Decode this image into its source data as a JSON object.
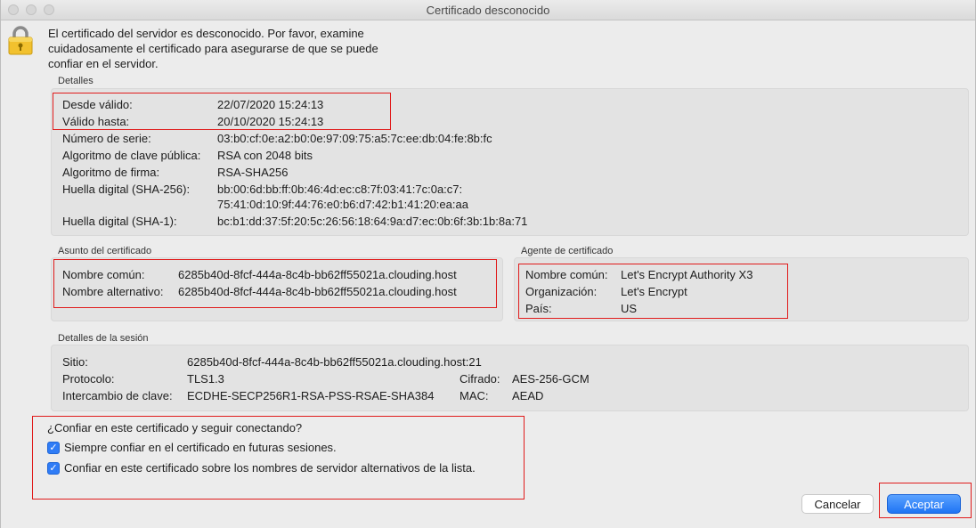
{
  "window": {
    "title": "Certificado desconocido"
  },
  "intro_text_lines": [
    "El certificado del servidor es desconocido. Por favor, examine",
    "cuidadosamente el certificado para asegurarse de que se puede",
    "confiar en el servidor."
  ],
  "details": {
    "label": "Detalles",
    "valid_from_label": "Desde válido:",
    "valid_from": "22/07/2020 15:24:13",
    "valid_until_label": "Válido hasta:",
    "valid_until": "20/10/2020 15:24:13",
    "serial_label": "Número de serie:",
    "serial": "03:b0:cf:0e:a2:b0:0e:97:09:75:a5:7c:ee:db:04:fe:8b:fc",
    "pubkey_label": "Algoritmo de clave pública:",
    "pubkey": "RSA con 2048 bits",
    "sig_label": "Algoritmo de firma:",
    "sig": "RSA-SHA256",
    "sha256_label": "Huella digital (SHA-256):",
    "sha256_line1": "bb:00:6d:bb:ff:0b:46:4d:ec:c8:7f:03:41:7c:0a:c7:",
    "sha256_line2": "75:41:0d:10:9f:44:76:e0:b6:d7:42:b1:41:20:ea:aa",
    "sha1_label": "Huella digital (SHA-1):",
    "sha1": "bc:b1:dd:37:5f:20:5c:26:56:18:64:9a:d7:ec:0b:6f:3b:1b:8a:71"
  },
  "subject": {
    "label": "Asunto del certificado",
    "cn_label": "Nombre común:",
    "cn": "6285b40d-8fcf-444a-8c4b-bb62ff55021a.clouding.host",
    "alt_label": "Nombre alternativo:",
    "alt": "6285b40d-8fcf-444a-8c4b-bb62ff55021a.clouding.host"
  },
  "issuer": {
    "label": "Agente de certificado",
    "cn_label": "Nombre común:",
    "cn": "Let's Encrypt Authority X3",
    "org_label": "Organización:",
    "org": "Let's Encrypt",
    "country_label": "País:",
    "country": "US"
  },
  "session": {
    "label": "Detalles de la sesión",
    "site_label": "Sitio:",
    "site": "6285b40d-8fcf-444a-8c4b-bb62ff55021a.clouding.host:21",
    "protocol_label": "Protocolo:",
    "protocol": "TLS1.3",
    "cipher_label": "Cifrado:",
    "cipher": "AES-256-GCM",
    "kex_label": "Intercambio de clave:",
    "kex": "ECDHE-SECP256R1-RSA-PSS-RSAE-SHA384",
    "mac_label": "MAC:",
    "mac": "AEAD"
  },
  "trust": {
    "question": "¿Confiar en este certificado y seguir conectando?",
    "always_label": "Siempre confiar en el certificado en futuras sesiones.",
    "alt_names_label": "Confiar en este certificado sobre los nombres de servidor alternativos de la lista."
  },
  "buttons": {
    "cancel": "Cancelar",
    "accept": "Aceptar"
  },
  "colors": {
    "accent": "#2f7cf6",
    "highlight_border": "#e01b1b"
  },
  "icons": {
    "lock": "padlock-icon",
    "check": "checkmark-icon"
  }
}
